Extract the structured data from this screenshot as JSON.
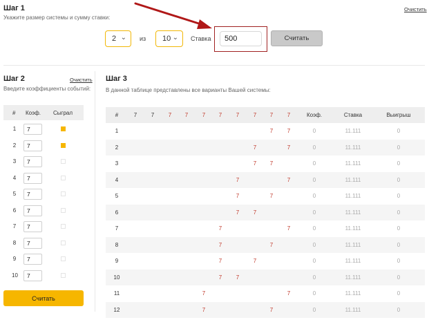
{
  "step1": {
    "title": "Шаг 1",
    "description": "Укажите размер системы и сумму ставки:",
    "clear_label": "Очистить",
    "system_size": "2",
    "of_label": "из",
    "total": "10",
    "stake_label": "Ставка",
    "stake_value": "500",
    "calc_label": "Считать"
  },
  "step2": {
    "title": "Шаг 2",
    "description": "Введите коэффициенты событий:",
    "clear_label": "Очистить",
    "headers": [
      "#",
      "Коэф.",
      "Сыграл"
    ],
    "rows": [
      {
        "n": "1",
        "coef": "7",
        "played": true
      },
      {
        "n": "2",
        "coef": "7",
        "played": true
      },
      {
        "n": "3",
        "coef": "7",
        "played": false
      },
      {
        "n": "4",
        "coef": "7",
        "played": false
      },
      {
        "n": "5",
        "coef": "7",
        "played": false
      },
      {
        "n": "6",
        "coef": "7",
        "played": false
      },
      {
        "n": "7",
        "coef": "7",
        "played": false
      },
      {
        "n": "8",
        "coef": "7",
        "played": false
      },
      {
        "n": "9",
        "coef": "7",
        "played": false
      },
      {
        "n": "10",
        "coef": "7",
        "played": false
      }
    ],
    "calc_label": "Считать"
  },
  "step3": {
    "title": "Шаг 3",
    "description": "В данной таблице представлены все варианты Вашей системы:",
    "headers": {
      "index": "#",
      "events": [
        "7",
        "7",
        "7",
        "7",
        "7",
        "7",
        "7",
        "7",
        "7",
        "7"
      ],
      "coef": "Коэф.",
      "stake": "Ставка",
      "win": "Выигрыш"
    },
    "rows": [
      {
        "n": "1",
        "picks": [
          9,
          10
        ],
        "coef": "0",
        "stake": "11.111",
        "win": "0"
      },
      {
        "n": "2",
        "picks": [
          8,
          10
        ],
        "coef": "0",
        "stake": "11.111",
        "win": "0"
      },
      {
        "n": "3",
        "picks": [
          8,
          9
        ],
        "coef": "0",
        "stake": "11.111",
        "win": "0"
      },
      {
        "n": "4",
        "picks": [
          7,
          10
        ],
        "coef": "0",
        "stake": "11.111",
        "win": "0"
      },
      {
        "n": "5",
        "picks": [
          7,
          9
        ],
        "coef": "0",
        "stake": "11.111",
        "win": "0"
      },
      {
        "n": "6",
        "picks": [
          7,
          8
        ],
        "coef": "0",
        "stake": "11.111",
        "win": "0"
      },
      {
        "n": "7",
        "picks": [
          6,
          10
        ],
        "coef": "0",
        "stake": "11.111",
        "win": "0"
      },
      {
        "n": "8",
        "picks": [
          6,
          9
        ],
        "coef": "0",
        "stake": "11.111",
        "win": "0"
      },
      {
        "n": "9",
        "picks": [
          6,
          8
        ],
        "coef": "0",
        "stake": "11.111",
        "win": "0"
      },
      {
        "n": "10",
        "picks": [
          6,
          7
        ],
        "coef": "0",
        "stake": "11.111",
        "win": "0"
      },
      {
        "n": "11",
        "picks": [
          5,
          10
        ],
        "coef": "0",
        "stake": "11.111",
        "win": "0"
      },
      {
        "n": "12",
        "picks": [
          5,
          9
        ],
        "coef": "0",
        "stake": "11.111",
        "win": "0"
      }
    ],
    "pick_mark": "7"
  },
  "icons": {
    "dropdown": "chevron-down-icon",
    "annotation": "red-arrow-icon"
  },
  "colors": {
    "accent": "#f6b600",
    "highlight_border": "#a02020",
    "pick_red": "#c0392b"
  }
}
